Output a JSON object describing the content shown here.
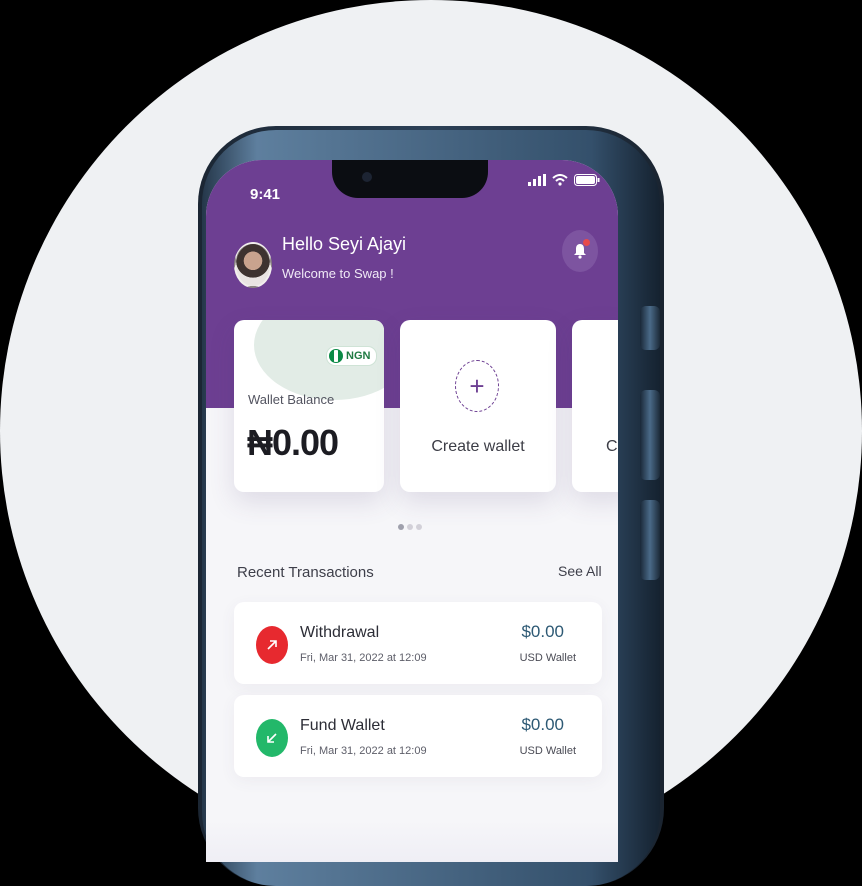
{
  "status_bar": {
    "time": "9:41"
  },
  "header": {
    "greeting": "Hello Seyi Ajayi",
    "subgreeting": "Welcome to Swap !"
  },
  "cards": {
    "balance": {
      "currency": "NGN",
      "label": "Wallet Balance",
      "value": "₦0.00"
    },
    "create": {
      "label": "Create wallet",
      "icon": "plus"
    },
    "third": {
      "label": "Cr"
    }
  },
  "pager": {
    "count": 3,
    "active": 1
  },
  "recent": {
    "title": "Recent Transactions",
    "see_all": "See All",
    "items": [
      {
        "name": "Withdrawal",
        "date": "Fri, Mar 31, 2022 at 12:09",
        "amount": "$0.00",
        "wallet": "USD Wallet",
        "icon": "arrow-up-right",
        "color": "#e7292f"
      },
      {
        "name": "Fund Wallet",
        "date": "Fri, Mar 31, 2022 at 12:09",
        "amount": "$0.00",
        "wallet": "USD Wallet",
        "icon": "arrow-down-left",
        "color": "#23b86a"
      }
    ]
  },
  "colors": {
    "brand": "#6d3f92",
    "background": "#eff1f3"
  }
}
